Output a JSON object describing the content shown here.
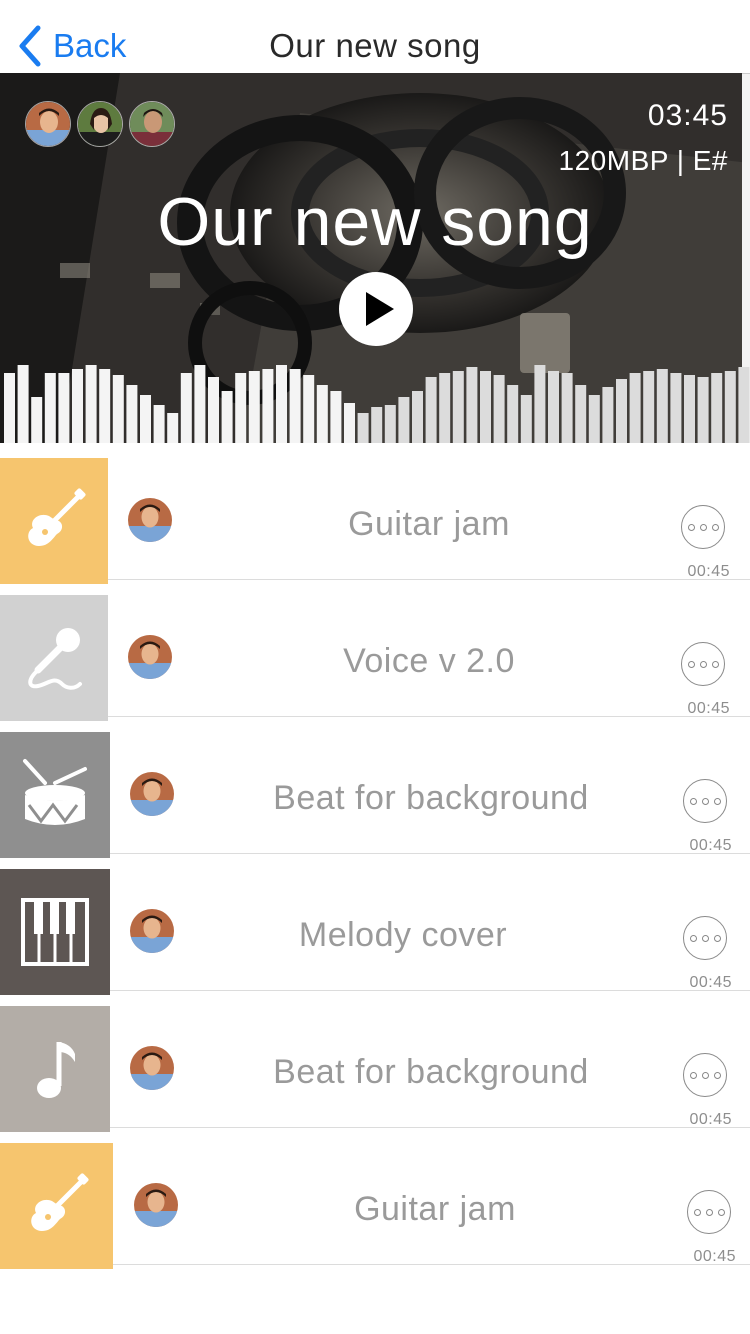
{
  "nav": {
    "back_label": "Back",
    "title": "Our new song"
  },
  "hero": {
    "collaborators": [
      "collaborator-1",
      "collaborator-2",
      "collaborator-3"
    ],
    "duration": "03:45",
    "meta": "120MBP | E#",
    "title": "Our new song",
    "play_icon": "play-icon"
  },
  "colors": {
    "accent": "#1a7cf0",
    "guitar": "#f6c56e",
    "voice": "#d1d1d1",
    "drum": "#8f8f8f",
    "piano": "#5d5653",
    "note": "#b3ada7",
    "text_muted": "#9a9a9a"
  },
  "tracks": [
    {
      "title": "Guitar jam",
      "icon": "guitar-icon",
      "color": "#f6c56e",
      "duration": "00:45"
    },
    {
      "title": "Voice v 2.0",
      "icon": "microphone-icon",
      "color": "#d1d1d1",
      "duration": "00:45"
    },
    {
      "title": "Beat for background",
      "icon": "drum-icon",
      "color": "#8f8f8f",
      "duration": "00:45"
    },
    {
      "title": "Melody cover",
      "icon": "piano-icon",
      "color": "#5d5653",
      "duration": "00:45"
    },
    {
      "title": "Beat for background",
      "icon": "music-note-icon",
      "color": "#b3ada7",
      "duration": "00:45"
    },
    {
      "title": "Guitar jam",
      "icon": "guitar-icon",
      "color": "#f6c56e",
      "duration": "00:45"
    }
  ]
}
